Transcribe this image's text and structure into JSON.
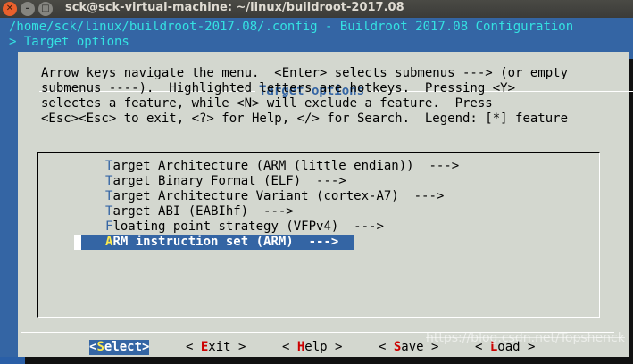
{
  "window": {
    "title": "sck@sck-virtual-machine: ~/linux/buildroot-2017.08",
    "close_glyph": "✕",
    "minimize_glyph": "–",
    "maximize_glyph": "□"
  },
  "header": {
    "line1": "/home/sck/linux/buildroot-2017.08/.config - Buildroot 2017.08 Configuration",
    "line2": "> Target options"
  },
  "dialog": {
    "title": "Target options",
    "help_lines": [
      "Arrow keys navigate the menu.  <Enter> selects submenus ---> (or empty",
      "submenus ----).  Highlighted letters are hotkeys.  Pressing <Y>",
      "selectes a feature, while <N> will exclude a feature.  Press",
      "<Esc><Esc> to exit, <?> for Help, </> for Search.  Legend: [*] feature"
    ]
  },
  "menu": {
    "items": [
      {
        "hotkey": "T",
        "rest": "arget Architecture (ARM (little endian))  --->"
      },
      {
        "hotkey": "T",
        "rest": "arget Binary Format (ELF)  --->"
      },
      {
        "hotkey": "T",
        "rest": "arget Architecture Variant (cortex-A7)  --->"
      },
      {
        "hotkey": "T",
        "rest": "arget ABI (EABIhf)  --->"
      },
      {
        "hotkey": "F",
        "rest": "loating point strategy (VFPv4)  --->"
      },
      {
        "hotkey": "A",
        "rest": "RM instruction set (ARM)  --->"
      }
    ],
    "selected_index": 5
  },
  "buttons": [
    {
      "pre": "<",
      "hotkey": "S",
      "rest": "elect>"
    },
    {
      "pre": "< ",
      "hotkey": "E",
      "rest": "xit >"
    },
    {
      "pre": "< ",
      "hotkey": "H",
      "rest": "elp >"
    },
    {
      "pre": "< ",
      "hotkey": "S",
      "rest": "ave >"
    },
    {
      "pre": "< ",
      "hotkey": "L",
      "rest": "oad >"
    }
  ],
  "watermark": "https://blog.csdn.net/Topshenck",
  "colors": {
    "terminal_bg": "#3465a4",
    "dialog_bg": "#d3d7cf",
    "header_text": "#34e2e2",
    "hotkey_menu": "#3465a4",
    "hotkey_button": "#cc0000",
    "selected_hotkey": "#fce94f"
  }
}
